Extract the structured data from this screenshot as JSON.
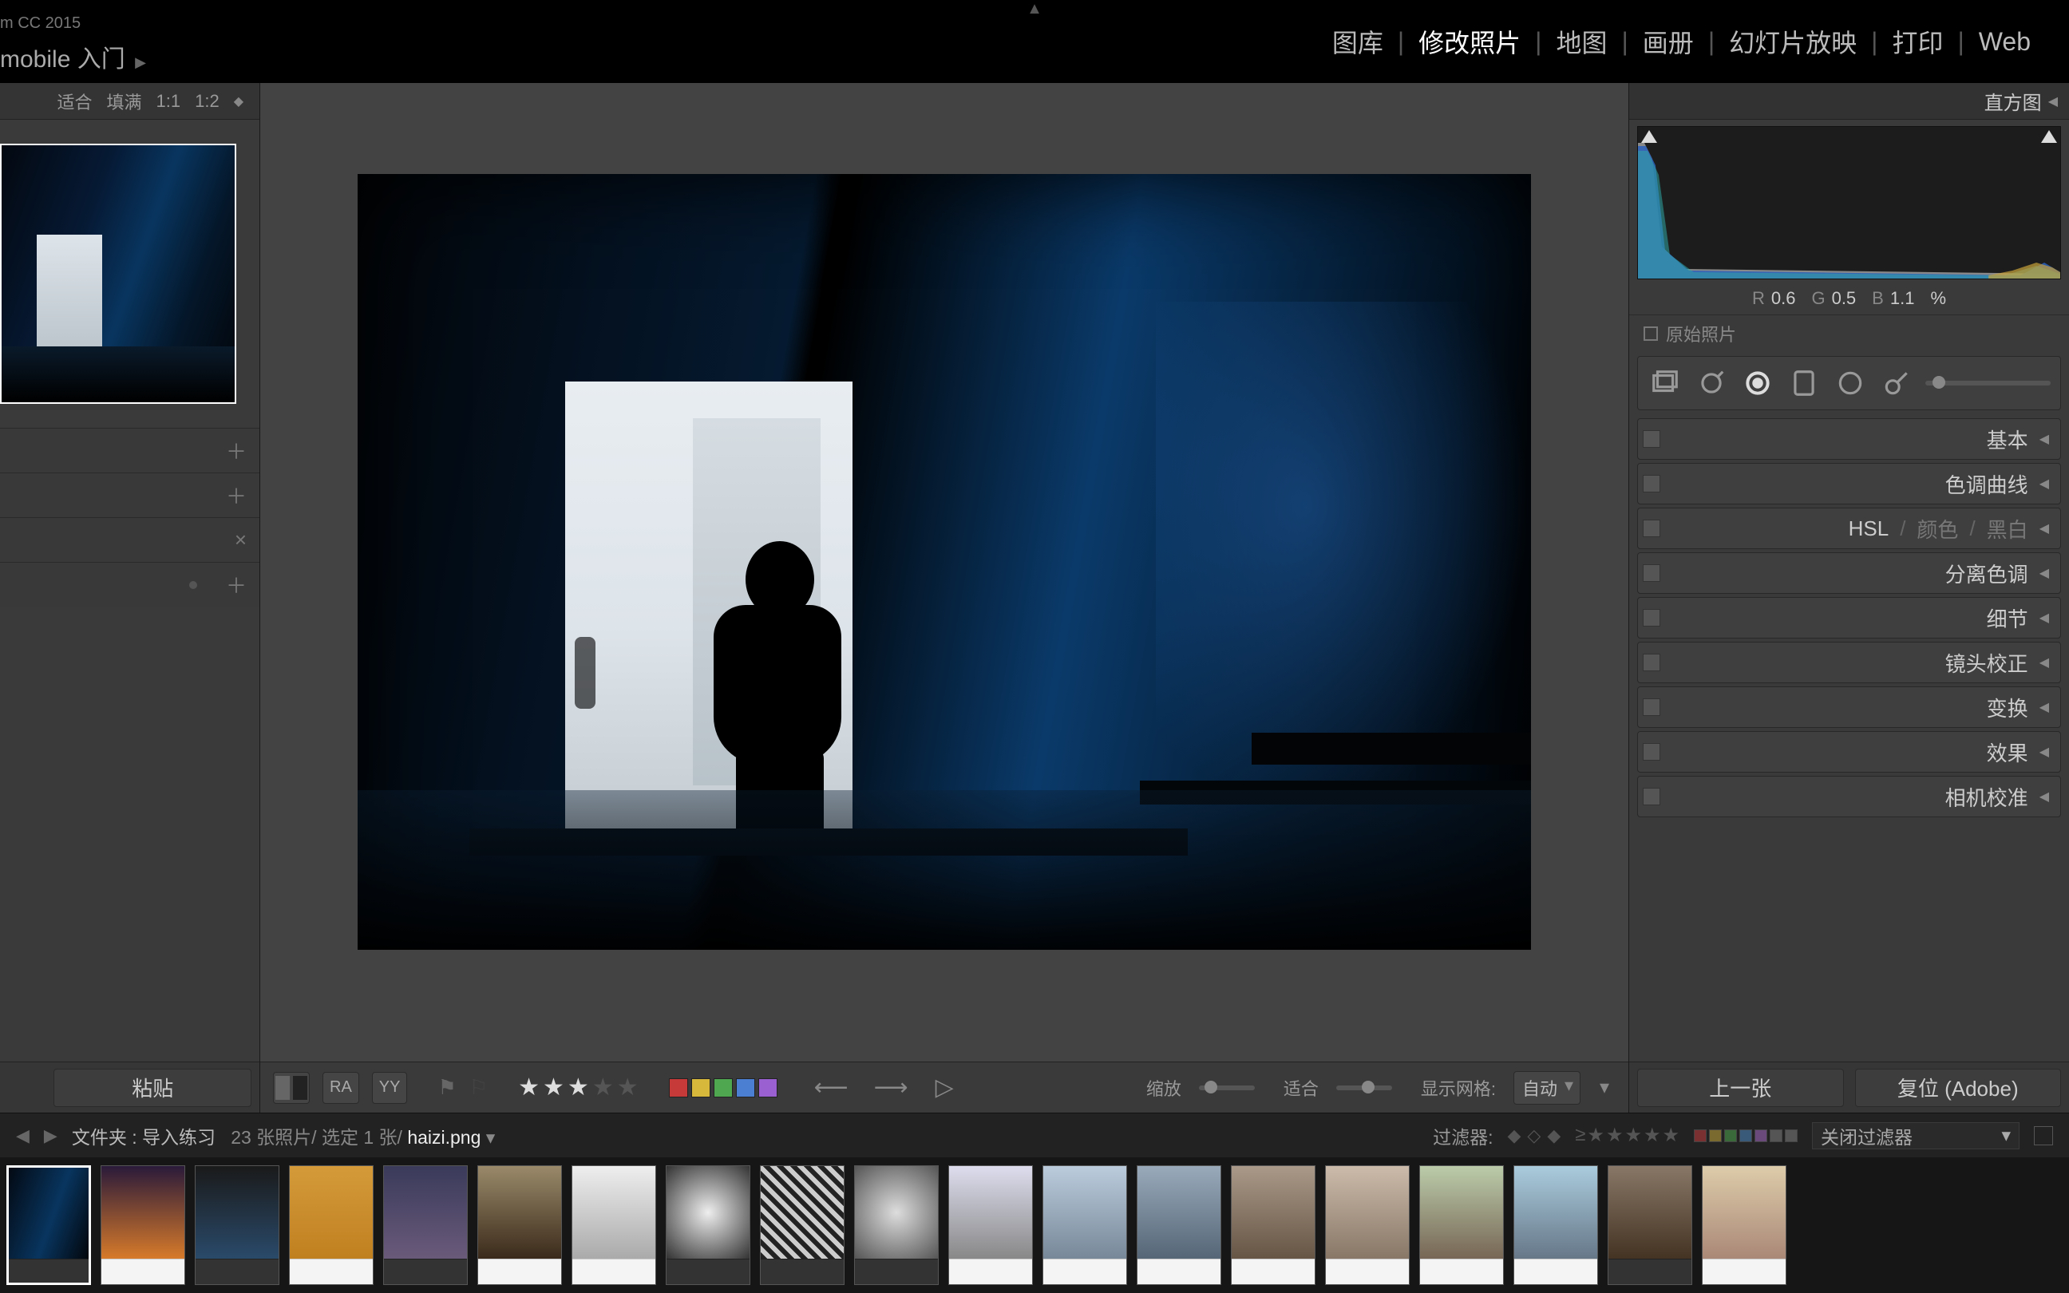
{
  "app_title": "m CC 2015",
  "mobile_link": "mobile 入门",
  "modules": {
    "items": [
      "图库",
      "修改照片",
      "地图",
      "画册",
      "幻灯片放映",
      "打印",
      "Web"
    ],
    "active_index": 1
  },
  "zoom": {
    "fit": "适合",
    "fill": "填满",
    "one_one": "1:1",
    "one_two": "1:2"
  },
  "left": {
    "paste": "粘贴"
  },
  "toolbar": {
    "ra": "RA",
    "yy": "YY",
    "rating": 3,
    "swatches": [
      "#c63a3a",
      "#d8b83a",
      "#4fa84f",
      "#4a7fd1",
      "#9a5fd1"
    ],
    "zoom_label": "缩放",
    "fit_label": "适合",
    "grid_label": "显示网格:",
    "grid_value": "自动"
  },
  "right": {
    "histogram_label": "直方图",
    "rgb": {
      "r_label": "R",
      "r": "0.6",
      "g_label": "G",
      "g": "0.5",
      "b_label": "B",
      "b": "1.1",
      "pct": "%"
    },
    "original_label": "原始照片",
    "panels": {
      "basic": "基本",
      "tone": "色调曲线",
      "hsl": "HSL",
      "color": "颜色",
      "bw": "黑白",
      "split": "分离色调",
      "detail": "细节",
      "lens": "镜头校正",
      "transform": "变换",
      "effects": "效果",
      "calib": "相机校准"
    },
    "prev": "上一张",
    "reset": "复位 (Adobe)"
  },
  "filterbar": {
    "path_prefix": "文件夹 :",
    "path_folder": "导入练习",
    "count": "23 张照片/",
    "selected": "选定 1 张/",
    "filename": "haizi.png",
    "filter_label": "过滤器:",
    "filter_select": "关闭过滤器",
    "sw": [
      "#7a3030",
      "#7a6a30",
      "#3a6a3a",
      "#3a5a7a",
      "#6a4a7a",
      "#555",
      "#555"
    ]
  },
  "thumbs": [
    {
      "bg": "linear-gradient(110deg,#030810,#08355f 55%,#020408)",
      "sel": true,
      "dark": true
    },
    {
      "bg": "linear-gradient(180deg,#2a1a3a,#d77a2a)",
      "dark": false
    },
    {
      "bg": "linear-gradient(180deg,#1a1a1a,#2a4a6a)",
      "dark": true
    },
    {
      "bg": "linear-gradient(180deg,#d49a3a,#c08020)",
      "dark": false
    },
    {
      "bg": "linear-gradient(180deg,#3a3a5a,#6a5a7a)",
      "dark": true
    },
    {
      "bg": "linear-gradient(180deg,#9a8a6a,#3a2a1a)",
      "dark": false
    },
    {
      "bg": "linear-gradient(180deg,#eee,#aaa)",
      "dark": false
    },
    {
      "bg": "radial-gradient(circle,#eee,#333)",
      "dark": true
    },
    {
      "bg": "repeating-linear-gradient(45deg,#222,#222 6px,#ccc 6px,#ccc 12px)",
      "dark": true
    },
    {
      "bg": "radial-gradient(circle,#ddd,#555)",
      "dark": true
    },
    {
      "bg": "linear-gradient(180deg,#dde,#888)",
      "dark": false
    },
    {
      "bg": "linear-gradient(180deg,#bcd,#789)",
      "dark": false
    },
    {
      "bg": "linear-gradient(180deg,#9ab,#567)",
      "dark": false
    },
    {
      "bg": "linear-gradient(180deg,#a98,#654)",
      "dark": false
    },
    {
      "bg": "linear-gradient(180deg,#cba,#876)",
      "dark": false
    },
    {
      "bg": "linear-gradient(180deg,#bca,#765)",
      "dark": false
    },
    {
      "bg": "linear-gradient(180deg,#acd,#678)",
      "dark": false
    },
    {
      "bg": "linear-gradient(180deg,#876,#432)",
      "dark": true
    },
    {
      "bg": "linear-gradient(180deg,#dca,#a87)",
      "dark": false
    }
  ]
}
